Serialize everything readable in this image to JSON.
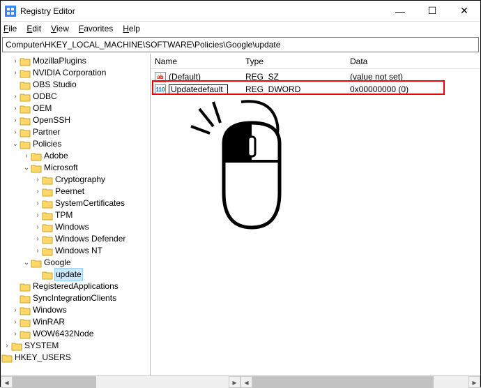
{
  "window": {
    "title": "Registry Editor",
    "min": "—",
    "max": "☐",
    "close": "✕"
  },
  "menu": {
    "file": "File",
    "edit": "Edit",
    "view": "View",
    "favorites": "Favorites",
    "help": "Help"
  },
  "address": "Computer\\HKEY_LOCAL_MACHINE\\SOFTWARE\\Policies\\Google\\update",
  "columns": {
    "name": "Name",
    "type": "Type",
    "data": "Data"
  },
  "rows": {
    "default": {
      "name": "(Default)",
      "type": "REG_SZ",
      "data": "(value not set)",
      "iconText": "ab"
    },
    "editing": {
      "name": "Updatedefault",
      "type": "REG_DWORD",
      "data": "0x00000000 (0)",
      "iconText": "110"
    }
  },
  "tree": {
    "items": [
      "MozillaPlugins",
      "NVIDIA Corporation",
      "OBS Studio",
      "ODBC",
      "OEM",
      "OpenSSH",
      "Partner",
      "Policies",
      "Adobe",
      "Microsoft",
      "Cryptography",
      "Peernet",
      "SystemCertificates",
      "TPM",
      "Windows",
      "Windows Defender",
      "Windows NT",
      "Google",
      "update",
      "RegisteredApplications",
      "SyncIntegrationClients",
      "Windows",
      "WinRAR",
      "WOW6432Node",
      "SYSTEM",
      "HKEY_USERS"
    ]
  }
}
